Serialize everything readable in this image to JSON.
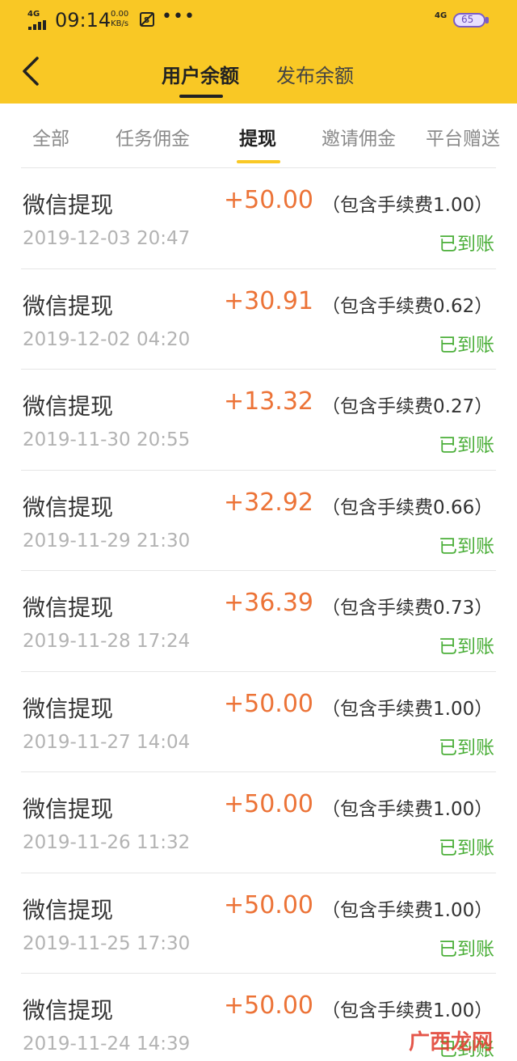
{
  "status_bar": {
    "network_left": "4G",
    "time": "09:14",
    "speed_value": "0.00",
    "speed_unit": "KB/s",
    "more": "•••",
    "network_right": "4G",
    "battery": "65"
  },
  "header": {
    "tabs": [
      {
        "label": "用户余额",
        "active": true
      },
      {
        "label": "发布余额",
        "active": false
      }
    ]
  },
  "filters": [
    {
      "label": "全部",
      "active": false
    },
    {
      "label": "任务佣金",
      "active": false
    },
    {
      "label": "提现",
      "active": true
    },
    {
      "label": "邀请佣金",
      "active": false
    },
    {
      "label": "平台赠送",
      "active": false
    }
  ],
  "records": [
    {
      "title": "微信提现",
      "amount": "+50.00",
      "fee": "（包含手续费1.00）",
      "time": "2019-12-03 20:47",
      "status": "已到账"
    },
    {
      "title": "微信提现",
      "amount": "+30.91",
      "fee": "（包含手续费0.62）",
      "time": "2019-12-02 04:20",
      "status": "已到账"
    },
    {
      "title": "微信提现",
      "amount": "+13.32",
      "fee": "（包含手续费0.27）",
      "time": "2019-11-30 20:55",
      "status": "已到账"
    },
    {
      "title": "微信提现",
      "amount": "+32.92",
      "fee": "（包含手续费0.66）",
      "time": "2019-11-29 21:30",
      "status": "已到账"
    },
    {
      "title": "微信提现",
      "amount": "+36.39",
      "fee": "（包含手续费0.73）",
      "time": "2019-11-28 17:24",
      "status": "已到账"
    },
    {
      "title": "微信提现",
      "amount": "+50.00",
      "fee": "（包含手续费1.00）",
      "time": "2019-11-27 14:04",
      "status": "已到账"
    },
    {
      "title": "微信提现",
      "amount": "+50.00",
      "fee": "（包含手续费1.00）",
      "time": "2019-11-26 11:32",
      "status": "已到账"
    },
    {
      "title": "微信提现",
      "amount": "+50.00",
      "fee": "（包含手续费1.00）",
      "time": "2019-11-25 17:30",
      "status": "已到账"
    },
    {
      "title": "微信提现",
      "amount": "+50.00",
      "fee": "（包含手续费1.00）",
      "time": "2019-11-24 14:39",
      "status": "已到账"
    }
  ],
  "watermark": "广西龙网",
  "colors": {
    "header_bg": "#f9c825",
    "amount": "#ec7337",
    "status_ok": "#4caf3a"
  }
}
